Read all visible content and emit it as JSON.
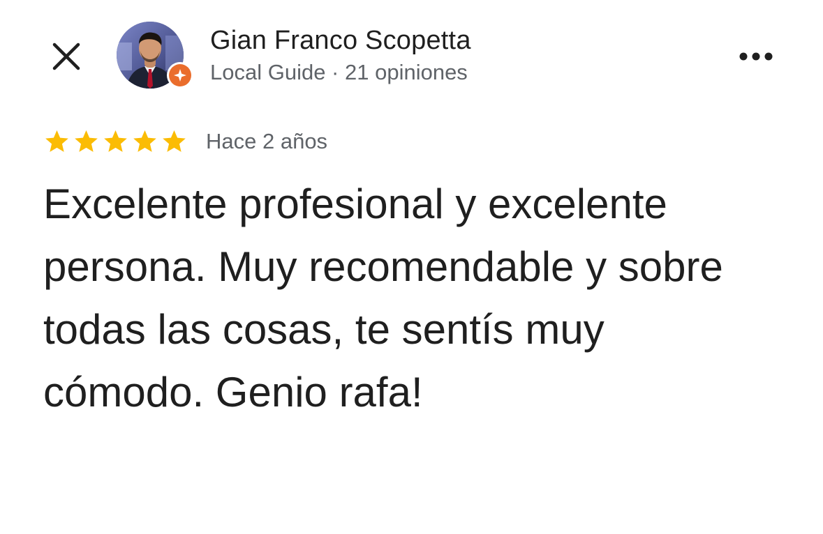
{
  "header": {
    "close_icon": "close-icon",
    "more_icon": "more-horizontal-icon"
  },
  "author": {
    "name": "Gian Franco Scopetta",
    "meta": "Local Guide · 21 opiniones",
    "badge_icon": "local-guide-star-icon",
    "badge_color": "#ea6d2c"
  },
  "review": {
    "rating": 5,
    "rating_max": 5,
    "star_color": "#fbbc04",
    "date": "Hace 2 años",
    "text": "Excelente profesional y excelente persona. Muy recomendable y sobre todas las cosas, te sentís muy cómodo. Genio rafa!"
  }
}
